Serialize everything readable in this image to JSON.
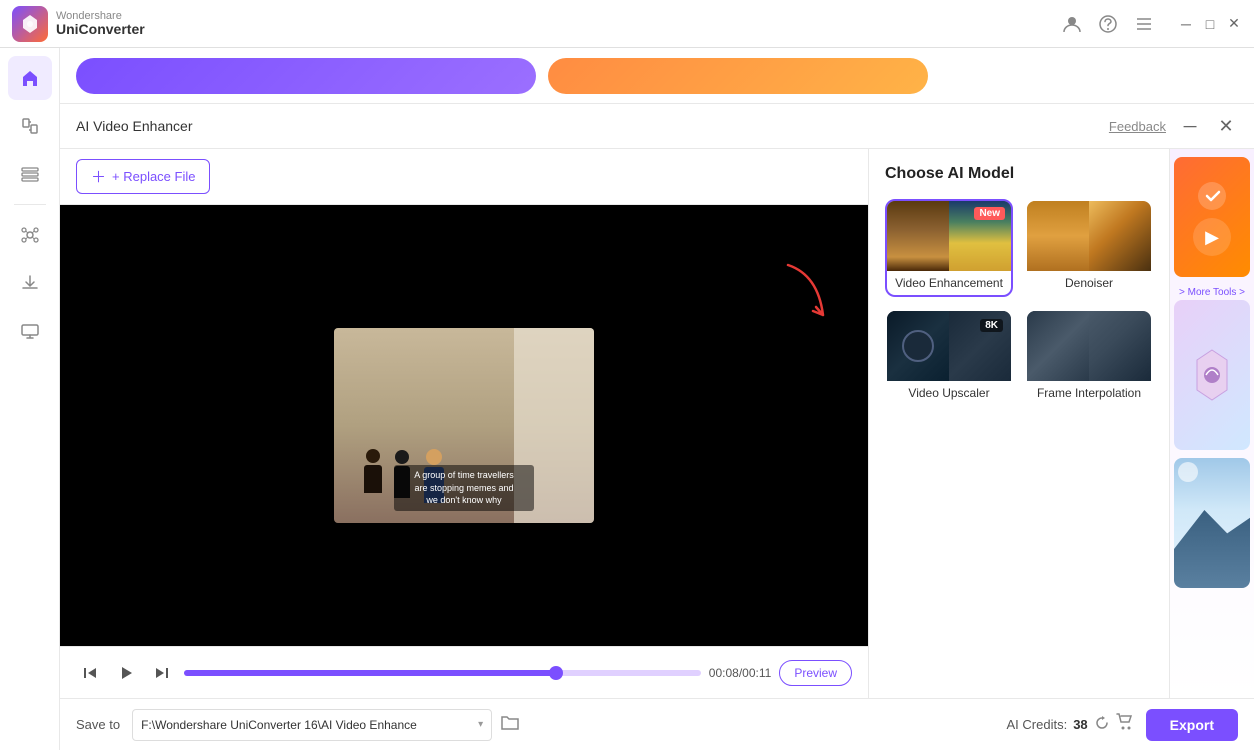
{
  "app": {
    "brand": "Wondershare",
    "product": "UniConverter"
  },
  "titlebar": {
    "user_icon": "👤",
    "headset_icon": "🎧",
    "menu_icon": "☰",
    "minimize": "—",
    "maximize": "□",
    "close": "✕"
  },
  "sidebar": {
    "items": [
      {
        "id": "home",
        "label": "Home",
        "active": true
      },
      {
        "id": "convert",
        "label": "Convert"
      },
      {
        "id": "tools",
        "label": "Tools"
      },
      {
        "id": "quick",
        "label": "Quick"
      },
      {
        "id": "ai",
        "label": "AI"
      },
      {
        "id": "download",
        "label": "Download"
      },
      {
        "id": "screen",
        "label": "Screen"
      }
    ]
  },
  "topnav": {
    "btn_purple_label": "",
    "btn_orange_label": ""
  },
  "panel": {
    "title": "AI Video Enhancer",
    "feedback_label": "Feedback",
    "replace_file_label": "+ Replace File"
  },
  "ai_model": {
    "title": "Choose AI Model",
    "models": [
      {
        "id": "video_enhancement",
        "label": "Video Enhancement",
        "selected": true,
        "badge": "New"
      },
      {
        "id": "denoiser",
        "label": "Denoiser",
        "selected": false,
        "badge": ""
      },
      {
        "id": "video_upscaler",
        "label": "Video Upscaler",
        "selected": false,
        "badge": "",
        "upscale": "8K"
      },
      {
        "id": "frame_interpolation",
        "label": "Frame Interpolation",
        "selected": false,
        "badge": ""
      }
    ]
  },
  "video": {
    "subtitle_line1": "A group of time travellers",
    "subtitle_line2": "are stopping memes and",
    "subtitle_line3": "we don't know why",
    "current_time": "00:08",
    "total_time": "00:11",
    "time_display": "00:08/00:11",
    "progress_percent": 72
  },
  "playback": {
    "preview_btn": "Preview"
  },
  "bottom_bar": {
    "save_to_label": "Save to",
    "path_value": "F:\\Wondershare UniConverter 16\\AI Video Enhance",
    "ai_credits_label": "AI Credits:",
    "ai_credits_value": "38",
    "export_label": "Export"
  },
  "more_tools": "> More Tools >"
}
